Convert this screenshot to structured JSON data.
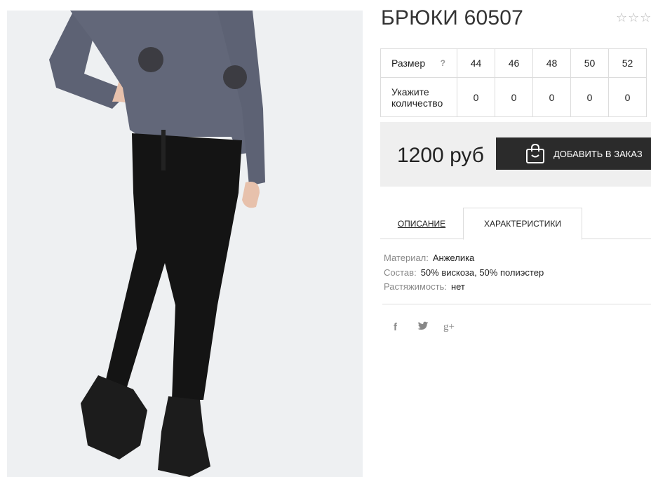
{
  "product": {
    "title": "БРЮКИ 60507",
    "rating_stars": "☆☆☆",
    "price": "1200 руб",
    "add_button_label": "ДОБАВИТЬ В ЗАКАЗ"
  },
  "size_table": {
    "size_label": "Размер",
    "help_mark": "?",
    "qty_label_line1": "Укажите",
    "qty_label_line2": "количество",
    "sizes": [
      "44",
      "46",
      "48",
      "50",
      "52"
    ],
    "quantities": [
      "0",
      "0",
      "0",
      "0",
      "0"
    ]
  },
  "tabs": {
    "description": "ОПИСАНИЕ",
    "characteristics": "ХАРАКТЕРИСТИКИ"
  },
  "specs": [
    {
      "key": "Материал:",
      "value": "Анжелика"
    },
    {
      "key": "Состав:",
      "value": "50% вискоза, 50% полиэстер"
    },
    {
      "key": "Растяжимость:",
      "value": "нет"
    }
  ],
  "social": {
    "facebook": "f",
    "twitter": "🐦",
    "googleplus": "g+"
  },
  "icons": {
    "rating": "star-icon",
    "bag": "shopping-bag-icon",
    "facebook": "facebook-icon",
    "twitter": "twitter-icon",
    "googleplus": "google-plus-icon"
  },
  "colors": {
    "button": "#2b2b2b",
    "price_box": "#efefef",
    "border": "#dcdcdc"
  }
}
